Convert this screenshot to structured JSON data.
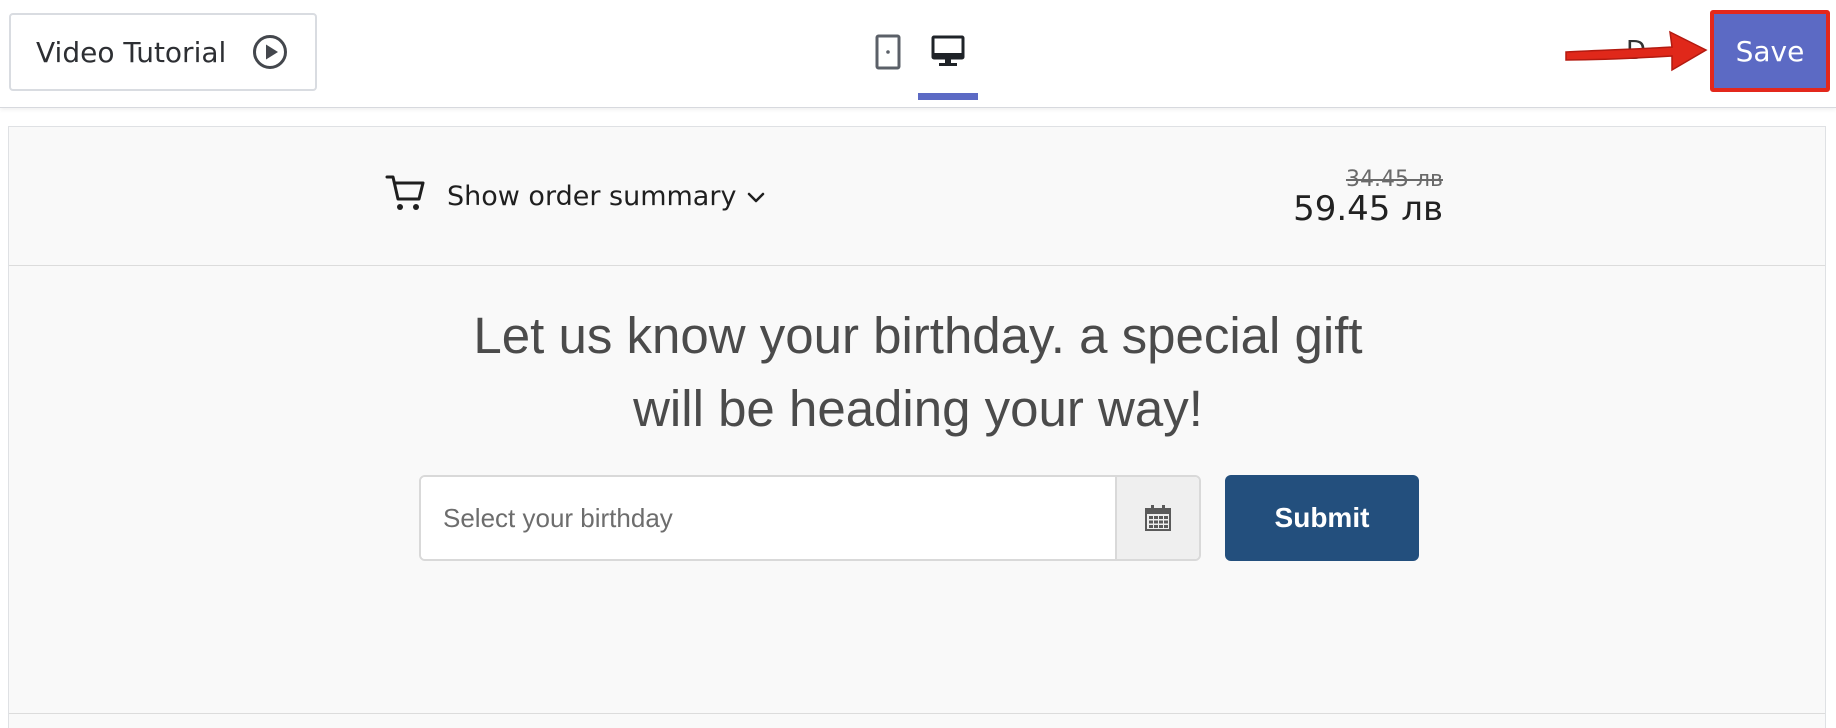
{
  "toolbar": {
    "video_tutorial_label": "Video Tutorial",
    "video_icon": "play-circle-icon",
    "device_mobile_icon": "mobile-device-icon",
    "device_desktop_icon": "desktop-monitor-icon",
    "active_device": "desktop",
    "save_label": "Save",
    "accent_color": "#5c6ac4",
    "highlight_color": "#e3281c"
  },
  "order_summary": {
    "toggle_label": "Show order summary",
    "cart_icon": "shopping-cart-icon",
    "chevron_icon": "chevron-down-icon",
    "original_price": "34.45 лв",
    "current_price": "59.45 лв"
  },
  "birthday_form": {
    "headline_line1": "Let us know your birthday. a special gift",
    "headline_line2": "will be heading your way!",
    "input_placeholder": "Select your birthday",
    "input_value": "",
    "calendar_icon": "calendar-icon",
    "submit_label": "Submit",
    "submit_color": "#234f7d"
  }
}
